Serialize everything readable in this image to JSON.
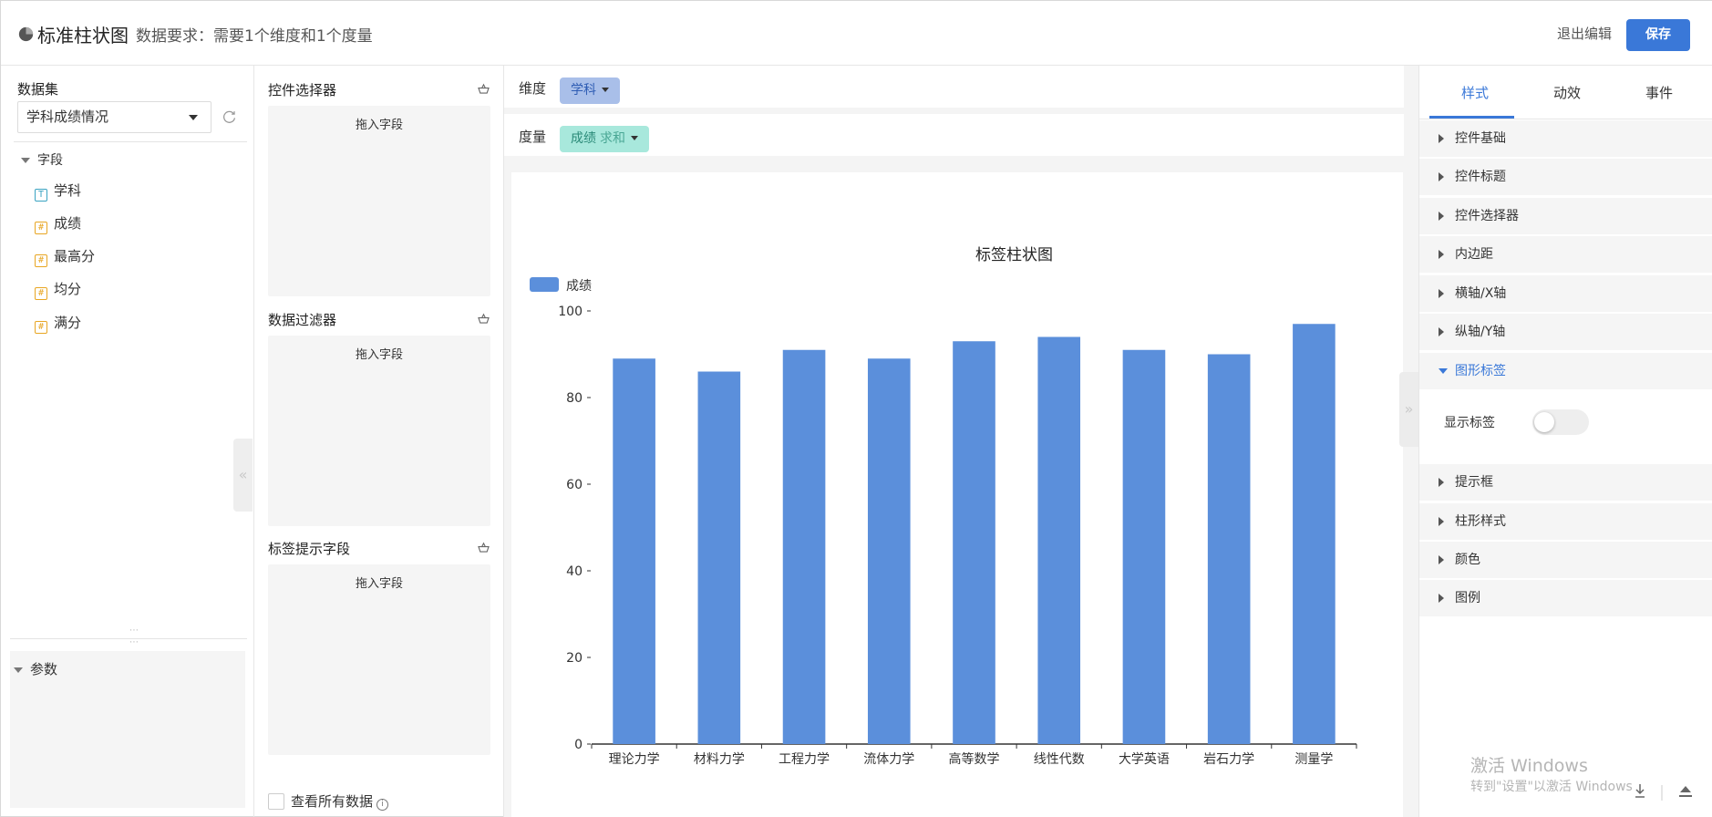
{
  "header": {
    "title": "标准柱状图",
    "subtitle": "数据要求：需要1个维度和1个度量",
    "exit_label": "退出编辑",
    "save_label": "保存",
    "save_color": "#3a78d8"
  },
  "dataset": {
    "label": "数据集",
    "selected": "学科成绩情况",
    "fields_header": "字段",
    "fields": [
      {
        "name": "学科",
        "type": "text"
      },
      {
        "name": "成绩",
        "type": "number"
      },
      {
        "name": "最高分",
        "type": "number"
      },
      {
        "name": "均分",
        "type": "number"
      },
      {
        "name": "满分",
        "type": "number"
      }
    ],
    "params_header": "参数"
  },
  "controls": {
    "selector_title": "控件选择器",
    "filter_title": "数据过滤器",
    "tooltip_title": "标签提示字段",
    "drop_hint": "拖入字段",
    "view_all": "查看所有数据"
  },
  "shelves": {
    "dimension_label": "维度",
    "dimension_value": "学科",
    "measure_label": "度量",
    "measure_value": "成绩",
    "measure_agg": "求和"
  },
  "chart_data": {
    "type": "bar",
    "title": "标签柱状图",
    "categories": [
      "理论力学",
      "材料力学",
      "工程力学",
      "流体力学",
      "高等数学",
      "线性代数",
      "大学英语",
      "岩石力学",
      "测量学"
    ],
    "series": [
      {
        "name": "成绩",
        "values": [
          89,
          86,
          91,
          89,
          93,
          94,
          91,
          90,
          97
        ],
        "color": "#5b8fdb"
      }
    ],
    "yticks": [
      0,
      20,
      40,
      60,
      80,
      100
    ],
    "ylim": [
      0,
      100
    ],
    "legend": "top-left"
  },
  "properties": {
    "tabs": [
      "样式",
      "动效",
      "事件"
    ],
    "active_tab": "样式",
    "sections": [
      "控件基础",
      "控件标题",
      "控件选择器",
      "内边距",
      "横轴/X轴",
      "纵轴/Y轴",
      "图形标签",
      "提示框",
      "柱形样式",
      "颜色",
      "图例"
    ],
    "open_section": "图形标签",
    "show_label_text": "显示标签",
    "show_label_on": false
  },
  "watermark": {
    "line1": "激活 Windows",
    "line2": "转到\"设置\"以激活 Windows"
  }
}
